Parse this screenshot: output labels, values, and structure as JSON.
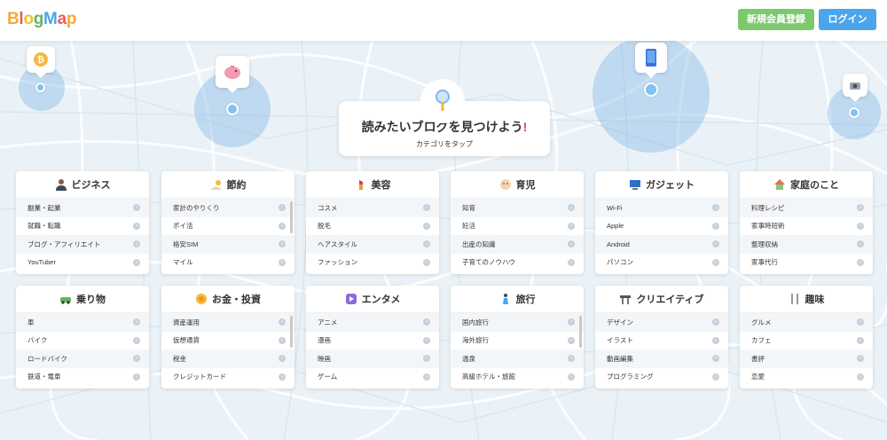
{
  "header": {
    "logo": [
      "B",
      "l",
      "o",
      "g",
      "M",
      "a",
      "p"
    ],
    "logo_colors": [
      "#f4a93b",
      "#e85e5e",
      "#f4c12e",
      "#64b764",
      "#4aa5ec",
      "#e85e5e",
      "#f4a93b"
    ],
    "register_label": "新規会員登録",
    "login_label": "ログイン"
  },
  "hero": {
    "title": "読みたいブログを見つけよう",
    "title_exclaim": "!",
    "subtitle": "カテゴリをタップ"
  },
  "categories": [
    {
      "title": "ビジネス",
      "icon": "business-person-icon",
      "items": [
        "副業・起業",
        "就職・転職",
        "ブログ・アフィリエイト",
        "YouTuber"
      ]
    },
    {
      "title": "節約",
      "icon": "savings-icon",
      "items": [
        "家計のやりくり",
        "ポイ活",
        "格安SIM",
        "マイル"
      ]
    },
    {
      "title": "美容",
      "icon": "lipstick-icon",
      "items": [
        "コスメ",
        "脱毛",
        "ヘアスタイル",
        "ファッション"
      ]
    },
    {
      "title": "育児",
      "icon": "baby-icon",
      "items": [
        "知育",
        "妊活",
        "出産の知識",
        "子育てのノウハウ"
      ]
    },
    {
      "title": "ガジェット",
      "icon": "computer-icon",
      "items": [
        "Wi-Fi",
        "Apple",
        "Android",
        "パソコン"
      ]
    },
    {
      "title": "家庭のこと",
      "icon": "house-icon",
      "items": [
        "料理レシピ",
        "家事時短術",
        "整理収納",
        "家事代行"
      ]
    },
    {
      "title": "乗り物",
      "icon": "car-icon",
      "items": [
        "車",
        "バイク",
        "ロードバイク",
        "鉄道・電車"
      ]
    },
    {
      "title": "お金・投資",
      "icon": "coin-icon",
      "items": [
        "資産運用",
        "仮想通貨",
        "税金",
        "クレジットカード"
      ]
    },
    {
      "title": "エンタメ",
      "icon": "play-icon",
      "items": [
        "アニメ",
        "漫画",
        "映画",
        "ゲーム"
      ]
    },
    {
      "title": "旅行",
      "icon": "traveler-icon",
      "items": [
        "国内旅行",
        "海外旅行",
        "温泉",
        "高級ホテル・旅館"
      ]
    },
    {
      "title": "クリエイティブ",
      "icon": "desk-icon",
      "items": [
        "デザイン",
        "イラスト",
        "動画編集",
        "プログラミング"
      ]
    },
    {
      "title": "趣味",
      "icon": "utensils-icon",
      "items": [
        "グルメ",
        "カフェ",
        "書評",
        "恋愛"
      ]
    }
  ]
}
